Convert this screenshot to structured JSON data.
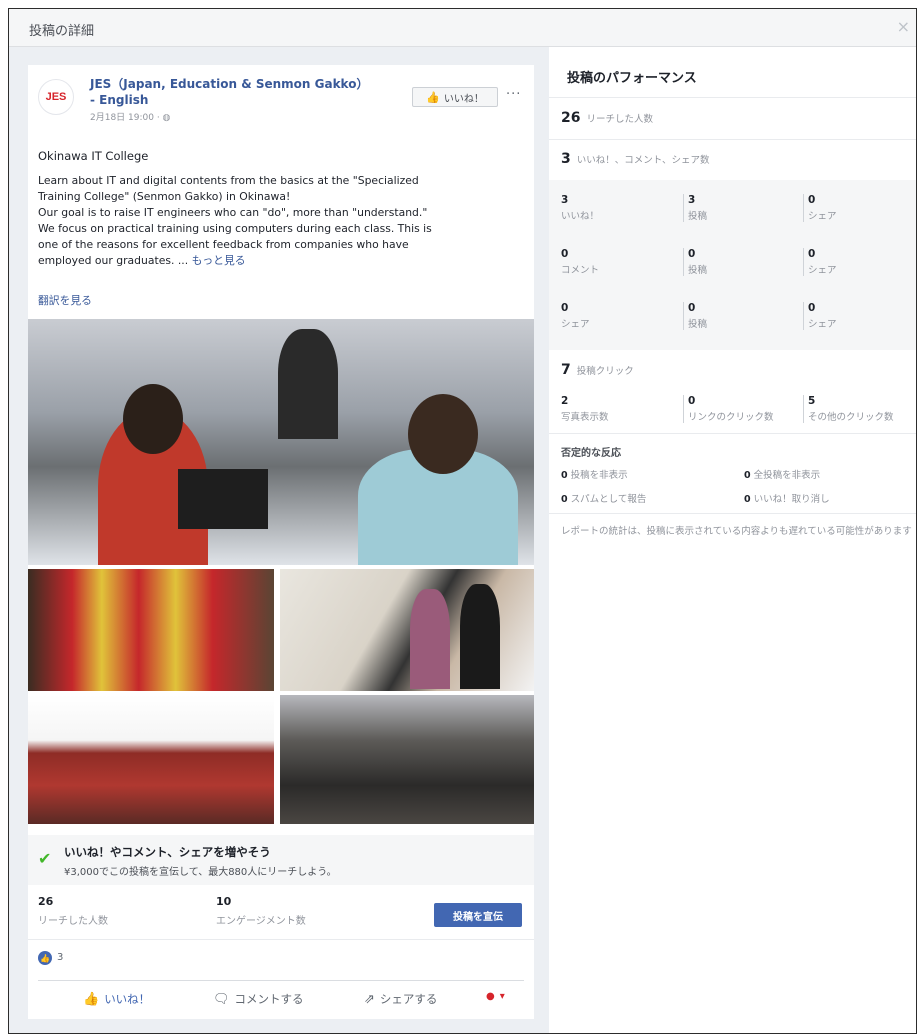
{
  "dialog": {
    "title": "投稿の詳細",
    "close_glyph": "×"
  },
  "post": {
    "avatar_text": "JES",
    "page_name_line1": "JES（Japan, Education & Senmon Gakko）",
    "page_name_line2": "- English",
    "time": "2月18日 19:00 · ◍",
    "like_page_label": "いいね！",
    "more_glyph": "···",
    "subject": "Okinawa IT College",
    "body_lines": [
      "Learn about IT and digital contents from the basics at the \"Specialized",
      "Training College\" (Senmon Gakko) in Okinawa!",
      "Our goal is to raise IT engineers who can \"do\", more than \"understand.\"",
      "We focus on practical training using computers during each class. This is",
      "one of the reasons for excellent feedback from companies who have"
    ],
    "body_last_line": "employed our graduates. ... ",
    "see_more": "もっと見る",
    "translate": "翻訳を見る",
    "promo_title": "いいね！やコメント、シェアを増やそう",
    "promo_sub": "¥3,000でこの投稿を宣伝して、最大880人にリーチしよう。",
    "reach_num": "26",
    "reach_label": "リーチした人数",
    "engagement_num": "10",
    "engagement_label": "エンゲージメント数",
    "boost_label": "投稿を宣伝",
    "reaction_count": "3",
    "action_like": "いいね！",
    "action_comment": "コメントする",
    "action_share": "シェアする",
    "action_more": "▾"
  },
  "performance": {
    "title": "投稿のパフォーマンス",
    "reach_num": "26",
    "reach_label": "リーチした人数",
    "reactions_num": "3",
    "reactions_label": "いいね！、コメント、シェア数",
    "grid": [
      [
        {
          "n": "3",
          "l": "いいね！"
        },
        {
          "n": "3",
          "l": "投稿"
        },
        {
          "n": "0",
          "l": "シェア"
        }
      ],
      [
        {
          "n": "0",
          "l": "コメント"
        },
        {
          "n": "0",
          "l": "投稿"
        },
        {
          "n": "0",
          "l": "シェア"
        }
      ],
      [
        {
          "n": "0",
          "l": "シェア"
        },
        {
          "n": "0",
          "l": "投稿"
        },
        {
          "n": "0",
          "l": "シェア"
        }
      ]
    ],
    "clicks_num": "7",
    "clicks_label": "投稿クリック",
    "clicks": [
      {
        "n": "2",
        "l": "写真表示数"
      },
      {
        "n": "0",
        "l": "リンクのクリック数"
      },
      {
        "n": "5",
        "l": "その他のクリック数"
      }
    ],
    "negative_title": "否定的な反応",
    "negative": [
      {
        "n": "0",
        "l": "投稿を非表示"
      },
      {
        "n": "0",
        "l": "全投稿を非表示"
      },
      {
        "n": "0",
        "l": "スパムとして報告"
      },
      {
        "n": "0",
        "l": "いいね！取り消し"
      }
    ],
    "note": "レポートの統計は、投稿に表示されている内容よりも遅れている可能性があります"
  },
  "colors": {
    "brand_blue": "#4267b2",
    "link_blue": "#385898",
    "check_green": "#42b72a"
  }
}
